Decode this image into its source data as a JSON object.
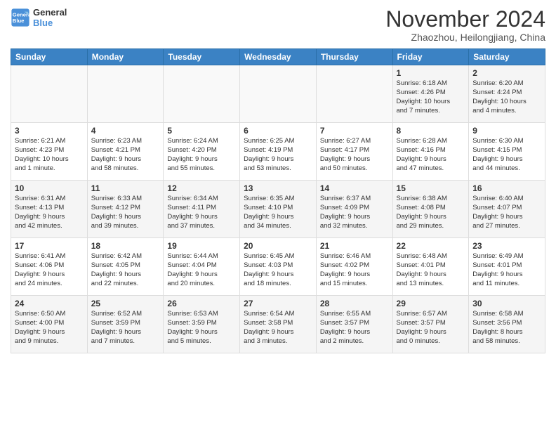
{
  "logo": {
    "line1": "General",
    "line2": "Blue"
  },
  "title": "November 2024",
  "subtitle": "Zhaozhou, Heilongjiang, China",
  "weekdays": [
    "Sunday",
    "Monday",
    "Tuesday",
    "Wednesday",
    "Thursday",
    "Friday",
    "Saturday"
  ],
  "rows": [
    [
      {
        "day": "",
        "info": ""
      },
      {
        "day": "",
        "info": ""
      },
      {
        "day": "",
        "info": ""
      },
      {
        "day": "",
        "info": ""
      },
      {
        "day": "",
        "info": ""
      },
      {
        "day": "1",
        "info": "Sunrise: 6:18 AM\nSunset: 4:26 PM\nDaylight: 10 hours\nand 7 minutes."
      },
      {
        "day": "2",
        "info": "Sunrise: 6:20 AM\nSunset: 4:24 PM\nDaylight: 10 hours\nand 4 minutes."
      }
    ],
    [
      {
        "day": "3",
        "info": "Sunrise: 6:21 AM\nSunset: 4:23 PM\nDaylight: 10 hours\nand 1 minute."
      },
      {
        "day": "4",
        "info": "Sunrise: 6:23 AM\nSunset: 4:21 PM\nDaylight: 9 hours\nand 58 minutes."
      },
      {
        "day": "5",
        "info": "Sunrise: 6:24 AM\nSunset: 4:20 PM\nDaylight: 9 hours\nand 55 minutes."
      },
      {
        "day": "6",
        "info": "Sunrise: 6:25 AM\nSunset: 4:19 PM\nDaylight: 9 hours\nand 53 minutes."
      },
      {
        "day": "7",
        "info": "Sunrise: 6:27 AM\nSunset: 4:17 PM\nDaylight: 9 hours\nand 50 minutes."
      },
      {
        "day": "8",
        "info": "Sunrise: 6:28 AM\nSunset: 4:16 PM\nDaylight: 9 hours\nand 47 minutes."
      },
      {
        "day": "9",
        "info": "Sunrise: 6:30 AM\nSunset: 4:15 PM\nDaylight: 9 hours\nand 44 minutes."
      }
    ],
    [
      {
        "day": "10",
        "info": "Sunrise: 6:31 AM\nSunset: 4:13 PM\nDaylight: 9 hours\nand 42 minutes."
      },
      {
        "day": "11",
        "info": "Sunrise: 6:33 AM\nSunset: 4:12 PM\nDaylight: 9 hours\nand 39 minutes."
      },
      {
        "day": "12",
        "info": "Sunrise: 6:34 AM\nSunset: 4:11 PM\nDaylight: 9 hours\nand 37 minutes."
      },
      {
        "day": "13",
        "info": "Sunrise: 6:35 AM\nSunset: 4:10 PM\nDaylight: 9 hours\nand 34 minutes."
      },
      {
        "day": "14",
        "info": "Sunrise: 6:37 AM\nSunset: 4:09 PM\nDaylight: 9 hours\nand 32 minutes."
      },
      {
        "day": "15",
        "info": "Sunrise: 6:38 AM\nSunset: 4:08 PM\nDaylight: 9 hours\nand 29 minutes."
      },
      {
        "day": "16",
        "info": "Sunrise: 6:40 AM\nSunset: 4:07 PM\nDaylight: 9 hours\nand 27 minutes."
      }
    ],
    [
      {
        "day": "17",
        "info": "Sunrise: 6:41 AM\nSunset: 4:06 PM\nDaylight: 9 hours\nand 24 minutes."
      },
      {
        "day": "18",
        "info": "Sunrise: 6:42 AM\nSunset: 4:05 PM\nDaylight: 9 hours\nand 22 minutes."
      },
      {
        "day": "19",
        "info": "Sunrise: 6:44 AM\nSunset: 4:04 PM\nDaylight: 9 hours\nand 20 minutes."
      },
      {
        "day": "20",
        "info": "Sunrise: 6:45 AM\nSunset: 4:03 PM\nDaylight: 9 hours\nand 18 minutes."
      },
      {
        "day": "21",
        "info": "Sunrise: 6:46 AM\nSunset: 4:02 PM\nDaylight: 9 hours\nand 15 minutes."
      },
      {
        "day": "22",
        "info": "Sunrise: 6:48 AM\nSunset: 4:01 PM\nDaylight: 9 hours\nand 13 minutes."
      },
      {
        "day": "23",
        "info": "Sunrise: 6:49 AM\nSunset: 4:01 PM\nDaylight: 9 hours\nand 11 minutes."
      }
    ],
    [
      {
        "day": "24",
        "info": "Sunrise: 6:50 AM\nSunset: 4:00 PM\nDaylight: 9 hours\nand 9 minutes."
      },
      {
        "day": "25",
        "info": "Sunrise: 6:52 AM\nSunset: 3:59 PM\nDaylight: 9 hours\nand 7 minutes."
      },
      {
        "day": "26",
        "info": "Sunrise: 6:53 AM\nSunset: 3:59 PM\nDaylight: 9 hours\nand 5 minutes."
      },
      {
        "day": "27",
        "info": "Sunrise: 6:54 AM\nSunset: 3:58 PM\nDaylight: 9 hours\nand 3 minutes."
      },
      {
        "day": "28",
        "info": "Sunrise: 6:55 AM\nSunset: 3:57 PM\nDaylight: 9 hours\nand 2 minutes."
      },
      {
        "day": "29",
        "info": "Sunrise: 6:57 AM\nSunset: 3:57 PM\nDaylight: 9 hours\nand 0 minutes."
      },
      {
        "day": "30",
        "info": "Sunrise: 6:58 AM\nSunset: 3:56 PM\nDaylight: 8 hours\nand 58 minutes."
      }
    ]
  ]
}
